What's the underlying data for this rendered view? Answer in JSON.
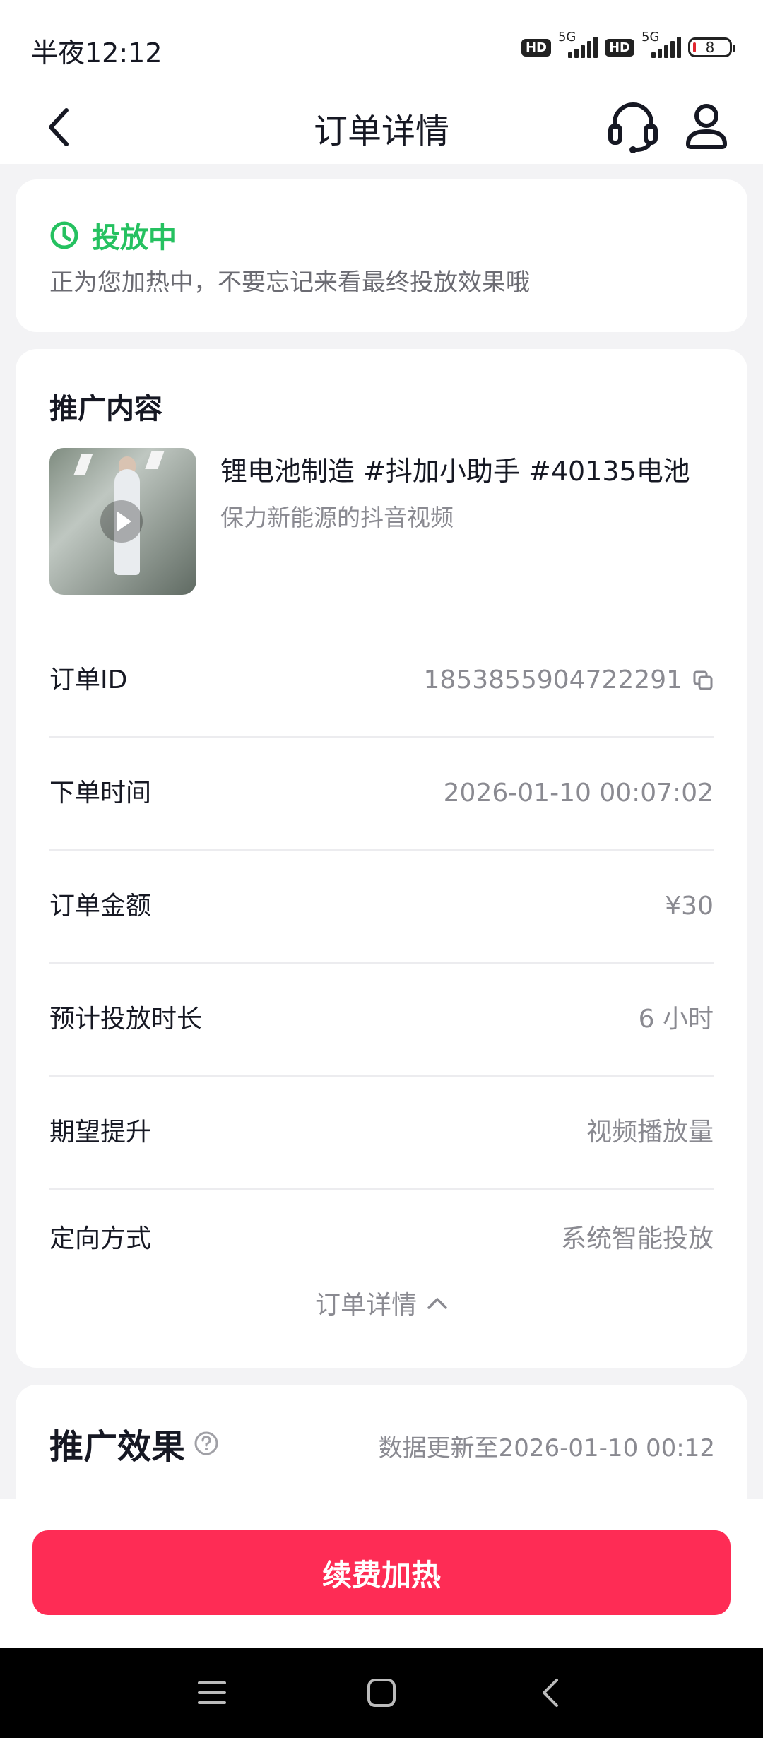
{
  "status_bar": {
    "time": "半夜12:12",
    "network1": "5G",
    "network2": "5G",
    "battery": "8"
  },
  "header": {
    "title": "订单详情"
  },
  "status": {
    "label": "投放中",
    "description": "正为您加热中，不要忘记来看最终投放效果哦",
    "color": "#25c160"
  },
  "content": {
    "section_title": "推广内容",
    "video_title": "锂电池制造 #抖加小助手 #40135电池",
    "video_sub": "保力新能源的抖音视频"
  },
  "details": [
    {
      "label": "订单ID",
      "value": "1853855904722291"
    },
    {
      "label": "下单时间",
      "value": "2026-01-10 00:07:02"
    },
    {
      "label": "订单金额",
      "value": "¥30"
    },
    {
      "label": "预计投放时长",
      "value": "6 小时"
    },
    {
      "label": "期望提升",
      "value": "视频播放量"
    },
    {
      "label": "定向方式",
      "value": "系统智能投放"
    }
  ],
  "collapse_label": "订单详情",
  "effect": {
    "title": "推广效果",
    "updated": "数据更新至2026-01-10 00:12"
  },
  "renew_button": {
    "label": "续费加热",
    "color": "#fe2c55"
  },
  "icons": [
    "back-icon",
    "headset-icon",
    "user-icon",
    "clock-icon",
    "play-icon",
    "copy-icon",
    "chevron-up-icon",
    "help-icon",
    "menu-icon",
    "home-icon",
    "nav-back-icon"
  ]
}
